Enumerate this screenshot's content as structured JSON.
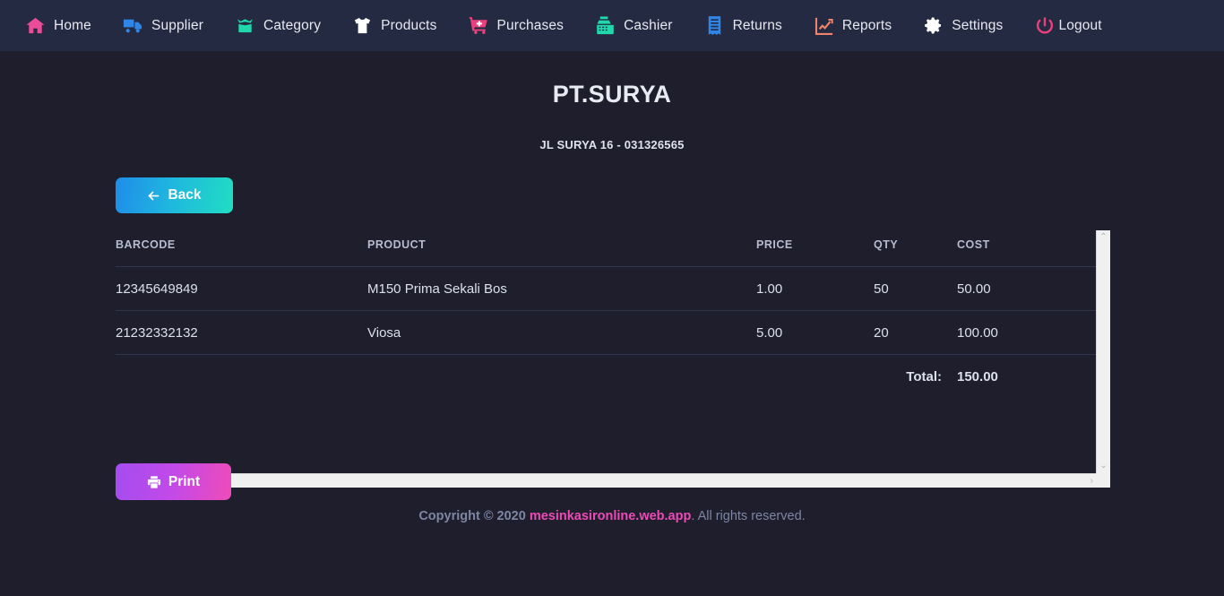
{
  "navbar": {
    "items": [
      {
        "label": "Home",
        "icon": "home-icon",
        "color": "#ea4c9a"
      },
      {
        "label": "Supplier",
        "icon": "truck-icon",
        "color": "#2f86e8"
      },
      {
        "label": "Category",
        "icon": "open-box-icon",
        "color": "#1fd9ad"
      },
      {
        "label": "Products",
        "icon": "tshirt-icon",
        "color": "#ffffff"
      },
      {
        "label": "Purchases",
        "icon": "cart-plus-icon",
        "color": "#ec3f7e"
      },
      {
        "label": "Cashier",
        "icon": "register-icon",
        "color": "#1fd9ad"
      },
      {
        "label": "Returns",
        "icon": "receipt-icon",
        "color": "#2f86e8"
      },
      {
        "label": "Reports",
        "icon": "chart-line-icon",
        "color": "#f2836b"
      },
      {
        "label": "Settings",
        "icon": "gear-icon",
        "color": "#ffffff"
      },
      {
        "label": "Logout",
        "icon": "power-icon",
        "color": "#ec3f7e"
      }
    ]
  },
  "store": {
    "name": "PT.SURYA",
    "address": "JL SURYA 16 - 031326565"
  },
  "actions": {
    "back_label": "Back",
    "print_label": "Print"
  },
  "table": {
    "columns": [
      "BARCODE",
      "PRODUCT",
      "PRICE",
      "QTY",
      "COST"
    ],
    "rows": [
      {
        "barcode": "12345649849",
        "product": "M150 Prima Sekali Bos",
        "price": "1.00",
        "qty": "50",
        "cost": "50.00"
      },
      {
        "barcode": "21232332132",
        "product": "Viosa",
        "price": "5.00",
        "qty": "20",
        "cost": "100.00"
      }
    ],
    "total_label": "Total:",
    "total_value": "150.00"
  },
  "scrollbars": {
    "up_arrow": "⌃",
    "down_arrow": "⌄",
    "left_arrow": "‹",
    "right_arrow": "›"
  },
  "footer": {
    "prefix": "Copyright © 2020 ",
    "link": "mesinkasironline.web.app",
    "suffix": ". All rights reserved."
  }
}
